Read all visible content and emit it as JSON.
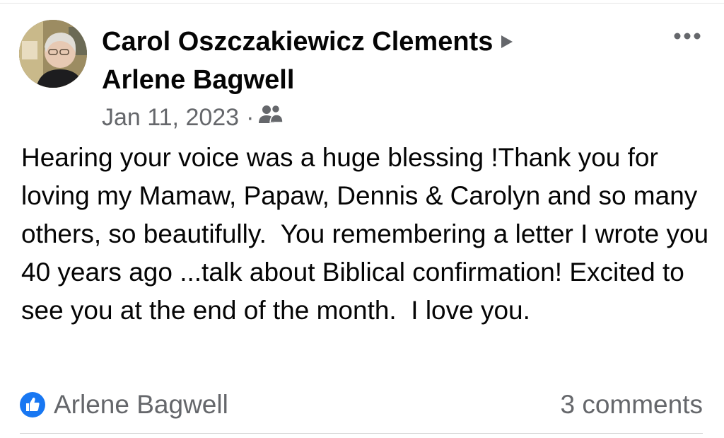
{
  "post": {
    "author": "Carol Oszczakiewicz Clements",
    "recipient": "Arlene Bagwell",
    "date": "Jan 11, 2023",
    "separator": "·",
    "audience_icon": "friends-icon",
    "text": "Hearing your voice was a huge blessing !Thank you for loving my Mamaw, Papaw, Dennis & Carolyn and so many others, so beautifully.  You remembering a letter I wrote you 40 years ago ...talk about Biblical confirmation! Excited to see you at the end of the month.  I love you.",
    "more_icon": "more-options-icon",
    "arrow_icon": "triangle-right-icon"
  },
  "footer": {
    "reaction_icon": "like-icon",
    "reactor": "Arlene Bagwell",
    "comments": "3 comments"
  },
  "colors": {
    "primary_text": "#050505",
    "secondary_text": "#65676b",
    "like_blue": "#1877f2"
  }
}
